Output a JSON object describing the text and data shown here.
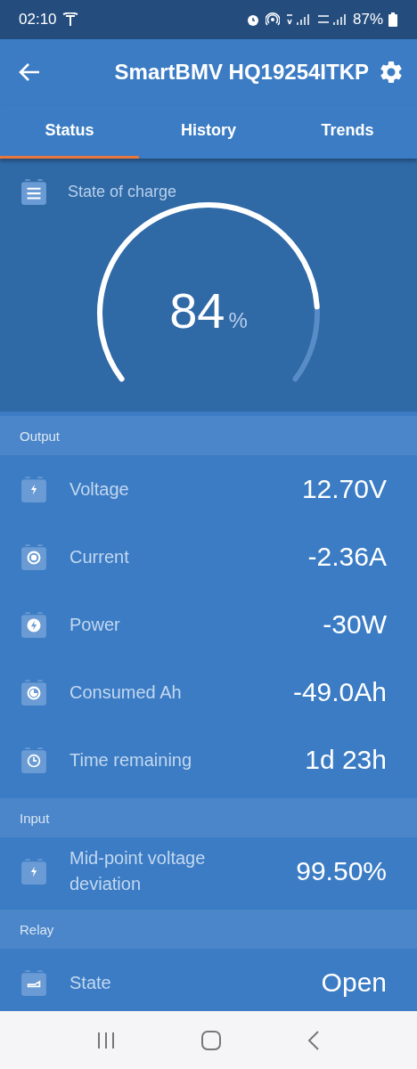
{
  "status_bar": {
    "time": "02:10",
    "battery": "87%"
  },
  "app_bar": {
    "title": "SmartBMV HQ19254ITKP"
  },
  "tabs": [
    {
      "label": "Status",
      "selected": true
    },
    {
      "label": "History",
      "selected": false
    },
    {
      "label": "Trends",
      "selected": false
    }
  ],
  "state_of_charge": {
    "label": "State of charge",
    "value": "84",
    "unit": "%"
  },
  "sections": [
    {
      "title": "Output",
      "rows": [
        {
          "kind": "voltage",
          "label": "Voltage",
          "value": "12.70V"
        },
        {
          "kind": "current",
          "label": "Current",
          "value": "-2.36A"
        },
        {
          "kind": "power",
          "label": "Power",
          "value": "-30W"
        },
        {
          "kind": "consumed",
          "label": "Consumed Ah",
          "value": "-49.0Ah"
        },
        {
          "kind": "time",
          "label": "Time remaining",
          "value": "1d 23h"
        }
      ]
    },
    {
      "title": "Input",
      "rows": [
        {
          "kind": "voltage",
          "label": "Mid-point voltage deviation",
          "value": "99.50%"
        }
      ]
    },
    {
      "title": "Relay",
      "rows": [
        {
          "kind": "relay",
          "label": "State",
          "value": "Open"
        }
      ]
    }
  ]
}
